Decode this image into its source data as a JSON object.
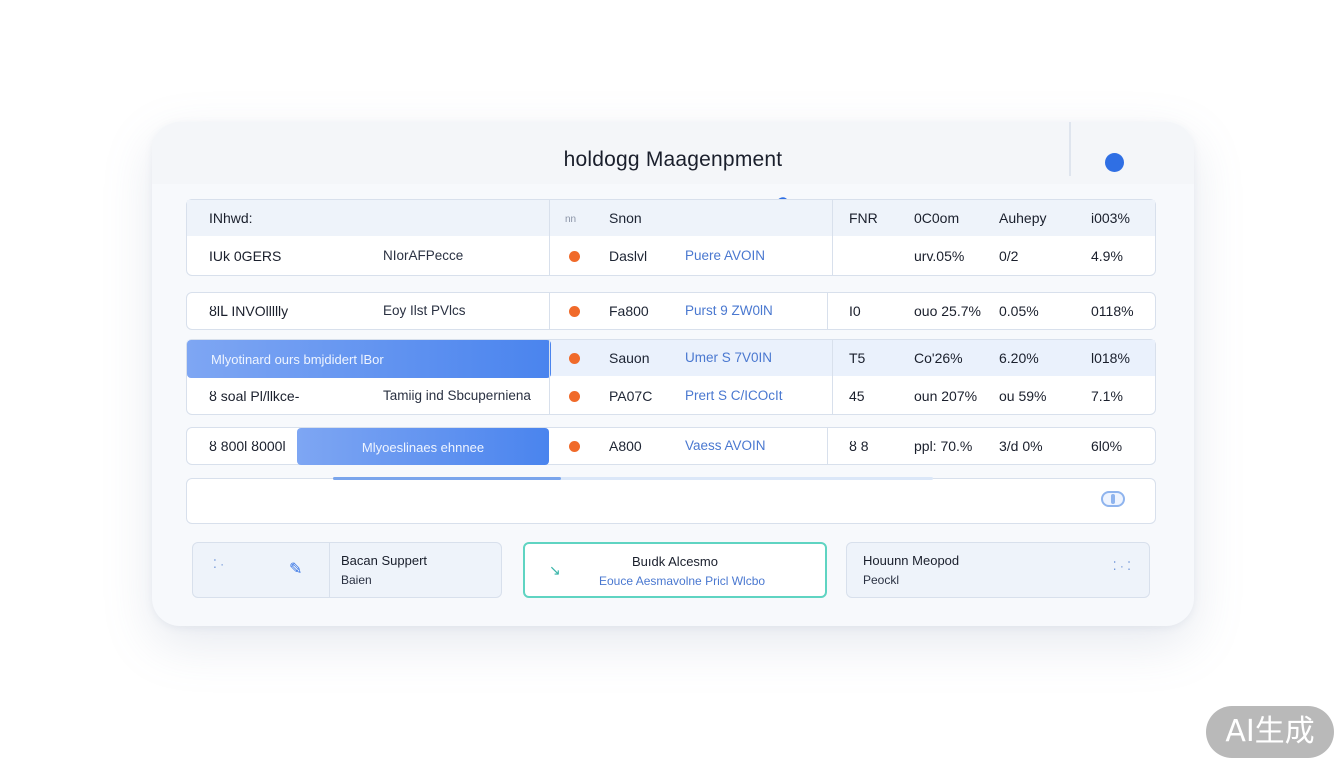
{
  "app": {
    "title": "holdogg Maagenpment"
  },
  "table": {
    "header": {
      "c1": "INhwd:",
      "sort": "nn",
      "c3": "Snon",
      "c5": "FNR",
      "c6": "0C0om",
      "c7": "Auhepy",
      "c8": "i003%"
    },
    "rows": [
      {
        "c1": "IUk 0GERS",
        "c2": "NIorAFPecce",
        "c4label": "Daslvl",
        "c4": "Puere AVOIN",
        "c5": "",
        "c6": "urv.05%",
        "c7": "0/2",
        "c8": "4.9%"
      },
      {
        "c1": "ȣlԼ INVOllllly",
        "c2": "Eoy Ilst PVlcs",
        "c4label": "Fa800",
        "c4": "Purst 9 ZW0lN",
        "c5": "I0",
        "c6": "ouo 25.7%",
        "c7": "0.05%",
        "c8": "0118%"
      },
      {
        "c1": "Mlyotinard ours bmjdidert lBor",
        "c2": "",
        "c4label": "Sauon",
        "c4": "Umer S 7V0IN",
        "c5": "T5",
        "c6": "Co'26%",
        "c7": "6.20%",
        "c8": "l018%"
      },
      {
        "c1": "ȣ soal Pl/llkce-",
        "c2": "Tamiig ind Sbcuperniena",
        "c4label": "PA07C",
        "c4": "Prert S C/ICOcIt",
        "c5": "45",
        "c6": "oun 207%",
        "c7": "ou 59%",
        "c8": "7.1%"
      },
      {
        "c1": "ȣ 800l ȣ000l",
        "c2": "Mlyoeslinaes ehnnee",
        "c4label": "A800",
        "c4": "Vaess AVOIN",
        "c5": "ȣ 8",
        "c6": "ppl: 70.%",
        "c7": "3/d 0%",
        "c8": "6l0%"
      }
    ]
  },
  "progress": {
    "value_fraction": 0.38
  },
  "tiles": [
    {
      "line1": "Bacan Suppert",
      "line2": "Baien"
    },
    {
      "line1": "Buıdk Alcesmo",
      "line2": "Eouce Aesmavolne Pricl Wlcbo"
    },
    {
      "line1": "Houunn Meopod",
      "line2": "Peockl"
    }
  ],
  "watermark": {
    "text": "AI生成"
  },
  "colors": {
    "accent": "#2f6fe4",
    "status_dot": "#f06a2a",
    "highlight": "#4a84ee",
    "tile_border_active": "#5fd4c2"
  },
  "icons": {
    "header_dot": "dot-icon",
    "toggle": "toggle-icon",
    "pin": "pin-icon",
    "arrow": "arrow-icon",
    "dots": "dots-icon"
  }
}
